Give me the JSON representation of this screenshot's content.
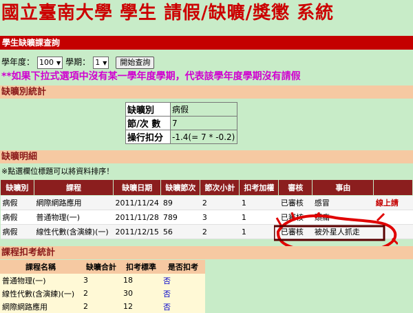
{
  "banner": {
    "title": "國立臺南大學 學生 請假/缺曠/獎懲 系統"
  },
  "query": {
    "header": "學生缺曠課查詢",
    "year_label": "學年度：",
    "year_value": "100",
    "term_label": "學期：",
    "term_value": "1",
    "submit_label": "開始查詢",
    "notice": "**如果下拉式選項中沒有某一學年度學期，代表該學年度學期沒有請假"
  },
  "stats": {
    "header": "缺曠別統計",
    "rows": [
      {
        "key": "缺曠別",
        "value": "病假"
      },
      {
        "key": "節/次 數",
        "value": "7"
      },
      {
        "key": "操行扣分",
        "value": "-1.4(= 7 * -0.2)"
      }
    ]
  },
  "detail": {
    "header": "缺曠明細",
    "hint": "※點選欄位標題可以將資料排序！",
    "columns": [
      "缺曠別",
      "課程",
      "缺曠日期",
      "缺曠節次",
      "節次小計",
      "扣考加權",
      "審核",
      "事由",
      ""
    ],
    "rows": [
      {
        "type": "病假",
        "course": "網際網路應用",
        "date": "2011/11/24",
        "period": "89",
        "subtotal": "2",
        "weight": "1",
        "status": "已審核",
        "reason": "感冒",
        "action": "線上請"
      },
      {
        "type": "病假",
        "course": "普通物理(一)",
        "date": "2011/11/28",
        "period": "789",
        "subtotal": "3",
        "weight": "1",
        "status": "已審核",
        "reason": "頭痛",
        "action": ""
      },
      {
        "type": "病假",
        "course": "線性代數(含演練)(一)",
        "date": "2011/12/15",
        "period": "56",
        "subtotal": "2",
        "weight": "1",
        "status": "已審核",
        "reason": "被外星人抓走",
        "action": ""
      }
    ]
  },
  "summary": {
    "header": "課程扣考統計",
    "columns": [
      "課程名稱",
      "缺曠合計",
      "扣考標準",
      "是否扣考"
    ],
    "rows": [
      {
        "course": "普通物理(一)",
        "total": "3",
        "standard": "18",
        "flag": "否"
      },
      {
        "course": "線性代數(含演練)(一)",
        "total": "2",
        "standard": "30",
        "flag": "否"
      },
      {
        "course": "網際網路應用",
        "total": "2",
        "standard": "12",
        "flag": "否"
      }
    ]
  },
  "colors": {
    "background": "#c8ecc8",
    "title": "#cc0000",
    "bar": "#c40000",
    "section": "#f6c9a2",
    "table_header": "#8b1e1e",
    "notice": "#d000d0",
    "scribble": "#e00000"
  }
}
